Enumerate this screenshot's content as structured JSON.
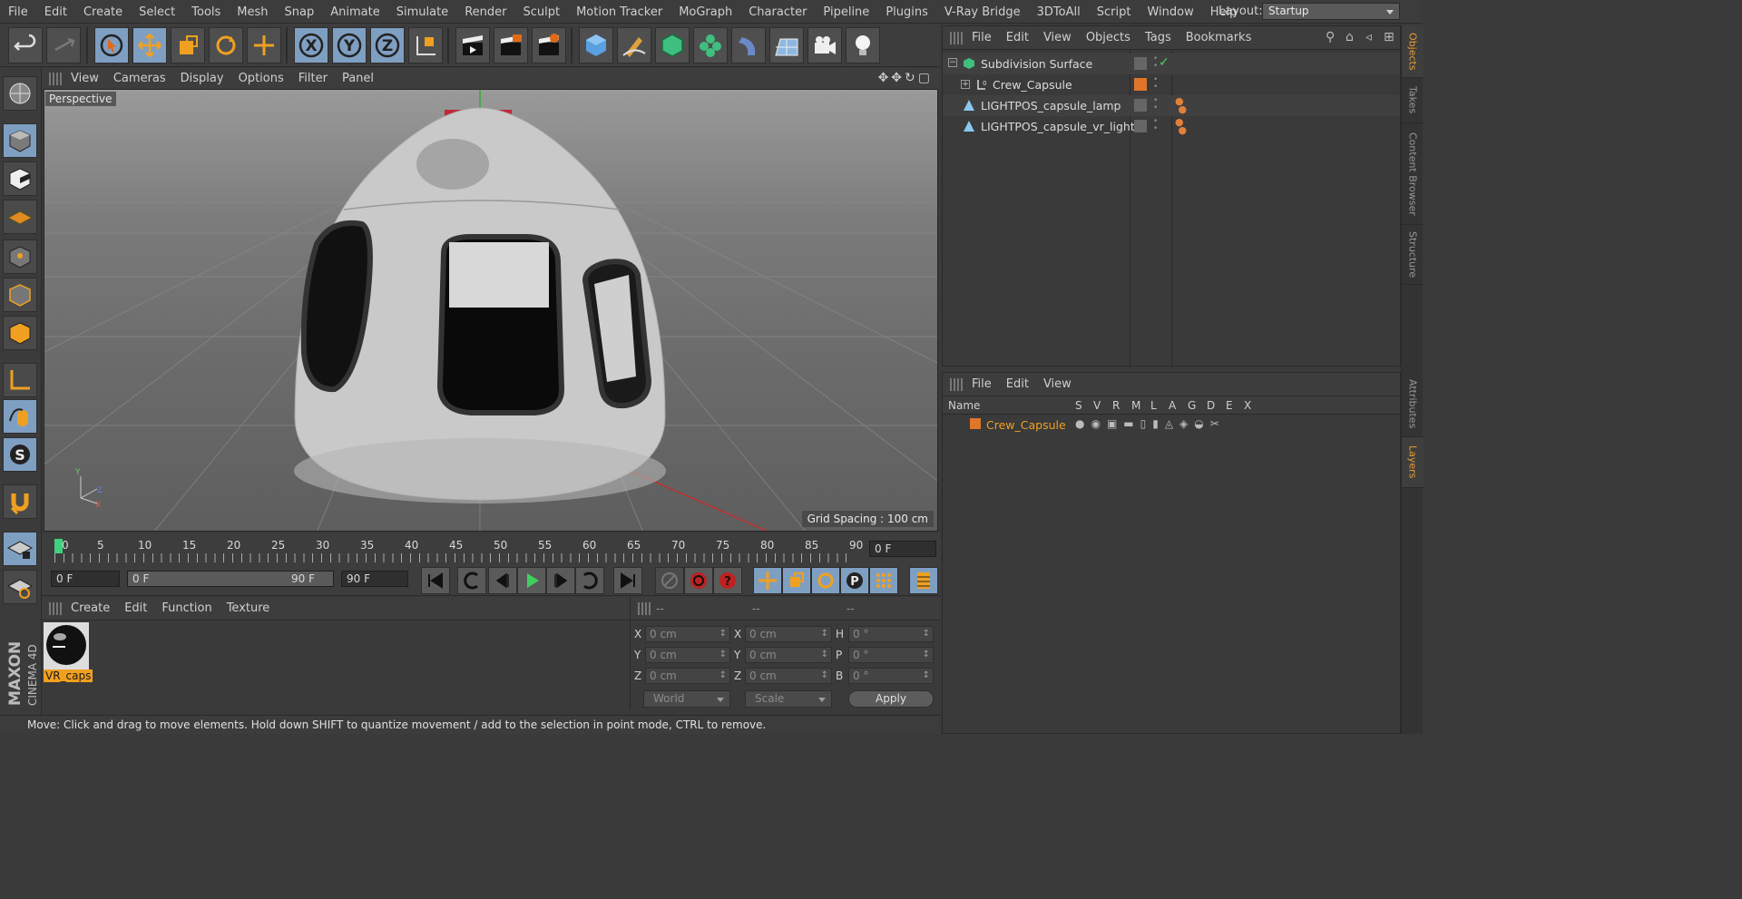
{
  "menu": {
    "items": [
      "File",
      "Edit",
      "Create",
      "Select",
      "Tools",
      "Mesh",
      "Snap",
      "Animate",
      "Simulate",
      "Render",
      "Sculpt",
      "Motion Tracker",
      "MoGraph",
      "Character",
      "Pipeline",
      "Plugins",
      "V-Ray Bridge",
      "3DToAll",
      "Script",
      "Window",
      "Help"
    ],
    "layout_label": "Layout:",
    "layout_value": "Startup"
  },
  "viewport": {
    "menu": [
      "View",
      "Cameras",
      "Display",
      "Options",
      "Filter",
      "Panel"
    ],
    "label": "Perspective",
    "grid_spacing": "Grid Spacing : 100 cm"
  },
  "timeline": {
    "ticks": [
      "0",
      "5",
      "10",
      "15",
      "20",
      "25",
      "30",
      "35",
      "40",
      "45",
      "50",
      "55",
      "60",
      "65",
      "70",
      "75",
      "80",
      "85",
      "90"
    ],
    "current_frame": "0 F",
    "start_field": "0 F",
    "range_start": "0 F",
    "range_end": "90 F",
    "end_field": "90 F"
  },
  "material": {
    "menu": [
      "Create",
      "Edit",
      "Function",
      "Texture"
    ],
    "name": "VR_caps"
  },
  "coords": {
    "headers": [
      "--",
      "--",
      "--"
    ],
    "rows": [
      {
        "l1": "X",
        "v1": "0 cm",
        "l2": "X",
        "v2": "0 cm",
        "l3": "H",
        "v3": "0 °"
      },
      {
        "l1": "Y",
        "v1": "0 cm",
        "l2": "Y",
        "v2": "0 cm",
        "l3": "P",
        "v3": "0 °"
      },
      {
        "l1": "Z",
        "v1": "0 cm",
        "l2": "Z",
        "v2": "0 cm",
        "l3": "B",
        "v3": "0 °"
      }
    ],
    "mode": "World",
    "scale": "Scale",
    "apply": "Apply"
  },
  "status": "Move: Click and drag to move elements. Hold down SHIFT to quantize movement / add to the selection in point mode, CTRL to remove.",
  "objects": {
    "menu": [
      "File",
      "Edit",
      "View",
      "Objects",
      "Tags",
      "Bookmarks"
    ],
    "items": [
      {
        "name": "Subdivision Surface",
        "icon": "subdivision-icon"
      },
      {
        "name": "Crew_Capsule",
        "icon": "null-object-icon"
      },
      {
        "name": "LIGHTPOS_capsule_lamp",
        "icon": "light-icon"
      },
      {
        "name": "LIGHTPOS_capsule_vr_light",
        "icon": "light-icon"
      }
    ]
  },
  "layers": {
    "menu": [
      "File",
      "Edit",
      "View"
    ],
    "columns": [
      "Name",
      "S",
      "V",
      "R",
      "M",
      "L",
      "A",
      "G",
      "D",
      "E",
      "X"
    ],
    "items": [
      {
        "name": "Crew_Capsule",
        "color": "#e0762a"
      }
    ]
  },
  "side_tabs": [
    "Objects",
    "Takes",
    "Content Browser",
    "Structure",
    "Attributes",
    "Layers"
  ],
  "logo": {
    "line1": "MAXON",
    "line2": "CINEMA 4D"
  },
  "colors": {
    "accent": "#f0a020",
    "selection_blue": "#7f9fc2",
    "layer_orange": "#e0762a"
  }
}
